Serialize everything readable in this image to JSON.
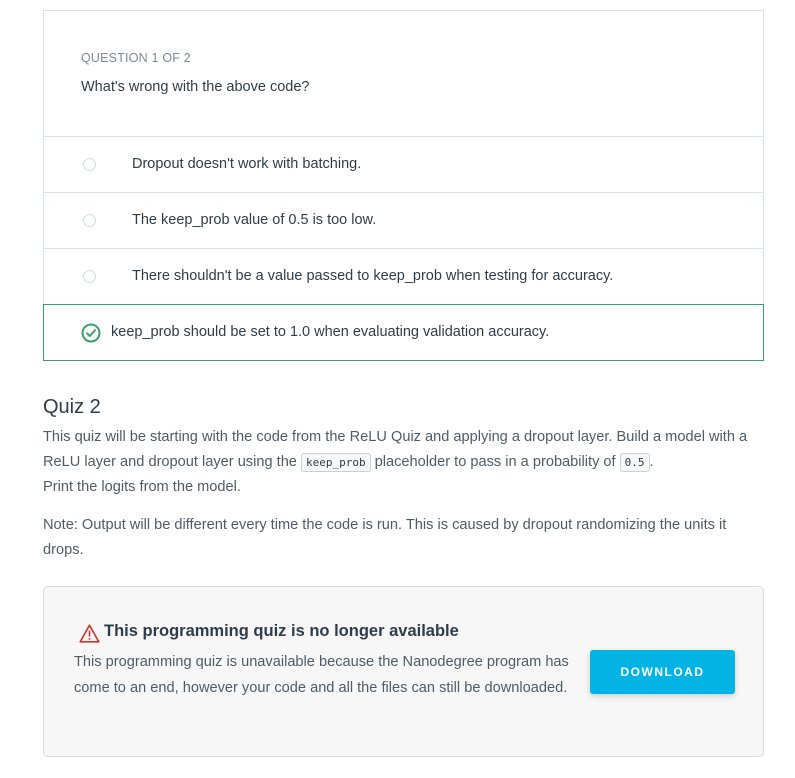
{
  "quiz": {
    "counter": "QUESTION 1 OF 2",
    "question": "What's wrong with the above code?",
    "options": [
      {
        "label": "Dropout doesn't work with batching."
      },
      {
        "label": "The keep_prob value of 0.5 is too low."
      },
      {
        "label": "There shouldn't be a value passed to keep_prob when testing for accuracy."
      }
    ],
    "correct_answer": {
      "label": "keep_prob should be set to 1.0 when evaluating validation accuracy.",
      "icon": "check-circle-icon",
      "color": "#3aa06b"
    }
  },
  "quiz2": {
    "title": "Quiz 2",
    "para1_part1": "This quiz will be starting with the code from the ReLU Quiz and applying a dropout layer. Build a model with a ReLU layer and dropout layer using the ",
    "para1_code1": "keep_prob",
    "para1_part2": " placeholder to pass in a probability of ",
    "para1_code2": "0.5",
    "para1_part3": ".",
    "para1_part4": "Print the logits from the model.",
    "para2": "Note: Output will be different every time the code is run. This is caused by dropout randomizing the units it drops."
  },
  "unavailable": {
    "icon": "warning-icon",
    "icon_color": "#d0342c",
    "title": "This programming quiz is no longer available",
    "text": "This programming quiz is unavailable because the Nanodegree program has come to an end, however your code and all the files can still be downloaded.",
    "download_label": "DOWNLOAD",
    "button_color": "#02b3e4"
  }
}
